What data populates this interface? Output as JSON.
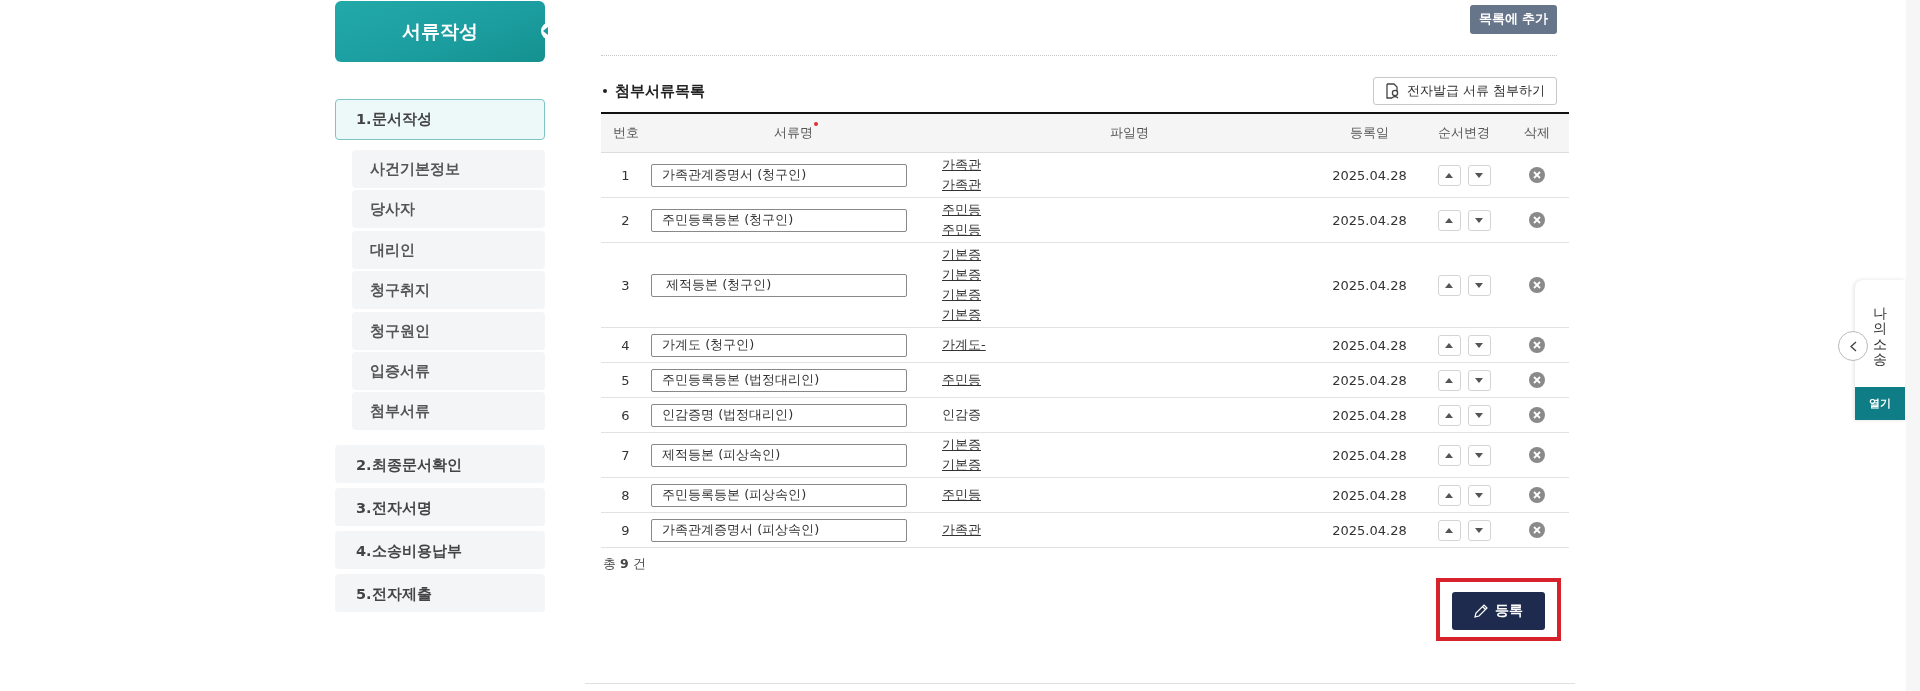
{
  "sidebar": {
    "title": "서류작성",
    "menu": [
      {
        "label": "1.문서작성",
        "selected": true,
        "children": [
          {
            "label": "사건기본정보",
            "selected": false
          },
          {
            "label": "당사자",
            "selected": false
          },
          {
            "label": "대리인",
            "selected": false
          },
          {
            "label": "청구취지",
            "selected": false
          },
          {
            "label": "청구원인",
            "selected": false
          },
          {
            "label": "입증서류",
            "selected": false
          },
          {
            "label": "첨부서류",
            "selected": false
          }
        ]
      },
      {
        "label": "2.최종문서확인",
        "selected": false
      },
      {
        "label": "3.전자서명",
        "selected": false
      },
      {
        "label": "4.소송비용납부",
        "selected": false
      },
      {
        "label": "5.전자제출",
        "selected": false
      }
    ]
  },
  "add_to_list_button": "목록에 추가",
  "section_title": "첨부서류목록",
  "attach_button": "전자발급 서류 첨부하기",
  "table": {
    "columns": [
      {
        "label": "번호",
        "required": false
      },
      {
        "label": "서류명",
        "required": true
      },
      {
        "label": "파일명",
        "required": false
      },
      {
        "label": "등록일",
        "required": false
      },
      {
        "label": "순서변경",
        "required": false
      },
      {
        "label": "삭제",
        "required": false
      }
    ],
    "rows": [
      {
        "number": "1",
        "name": "가족관계증명서 (청구인)",
        "files": [
          {
            "text": "가족관",
            "link": true
          },
          {
            "text": "가족관",
            "link": true
          }
        ],
        "date": "2025.04.28"
      },
      {
        "number": "2",
        "name": "주민등록등본 (청구인)",
        "files": [
          {
            "text": "주민등",
            "link": true
          },
          {
            "text": "주민등",
            "link": true
          }
        ],
        "date": "2025.04.28"
      },
      {
        "number": "3",
        "name": " 제적등본 (청구인)",
        "files": [
          {
            "text": "기본증",
            "link": true
          },
          {
            "text": "기본증",
            "link": true
          },
          {
            "text": "기본증",
            "link": true
          },
          {
            "text": "기본증",
            "link": true
          }
        ],
        "date": "2025.04.28"
      },
      {
        "number": "4",
        "name": "가계도 (청구인)",
        "files": [
          {
            "text": "가계도-",
            "link": true
          }
        ],
        "date": "2025.04.28"
      },
      {
        "number": "5",
        "name": "주민등록등본 (법정대리인)",
        "files": [
          {
            "text": "주민등",
            "link": true
          }
        ],
        "date": "2025.04.28"
      },
      {
        "number": "6",
        "name": "인감증명 (법정대리인)",
        "files": [
          {
            "text": "인감증",
            "link": false
          }
        ],
        "date": "2025.04.28"
      },
      {
        "number": "7",
        "name": "제적등본 (피상속인)",
        "files": [
          {
            "text": "기본증",
            "link": true
          },
          {
            "text": "기본증",
            "link": true
          }
        ],
        "date": "2025.04.28"
      },
      {
        "number": "8",
        "name": "주민등록등본 (피상속인)",
        "files": [
          {
            "text": "주민등",
            "link": true
          }
        ],
        "date": "2025.04.28"
      },
      {
        "number": "9",
        "name": "가족관계증명서 (피상속인)",
        "files": [
          {
            "text": "가족관",
            "link": true
          }
        ],
        "date": "2025.04.28"
      }
    ]
  },
  "total": {
    "prefix": "총",
    "count": "9",
    "suffix": "건"
  },
  "register_button": {
    "label": "등록",
    "highlighted": true
  },
  "side_tab": {
    "title": "나의소송",
    "open_button": "열기"
  }
}
